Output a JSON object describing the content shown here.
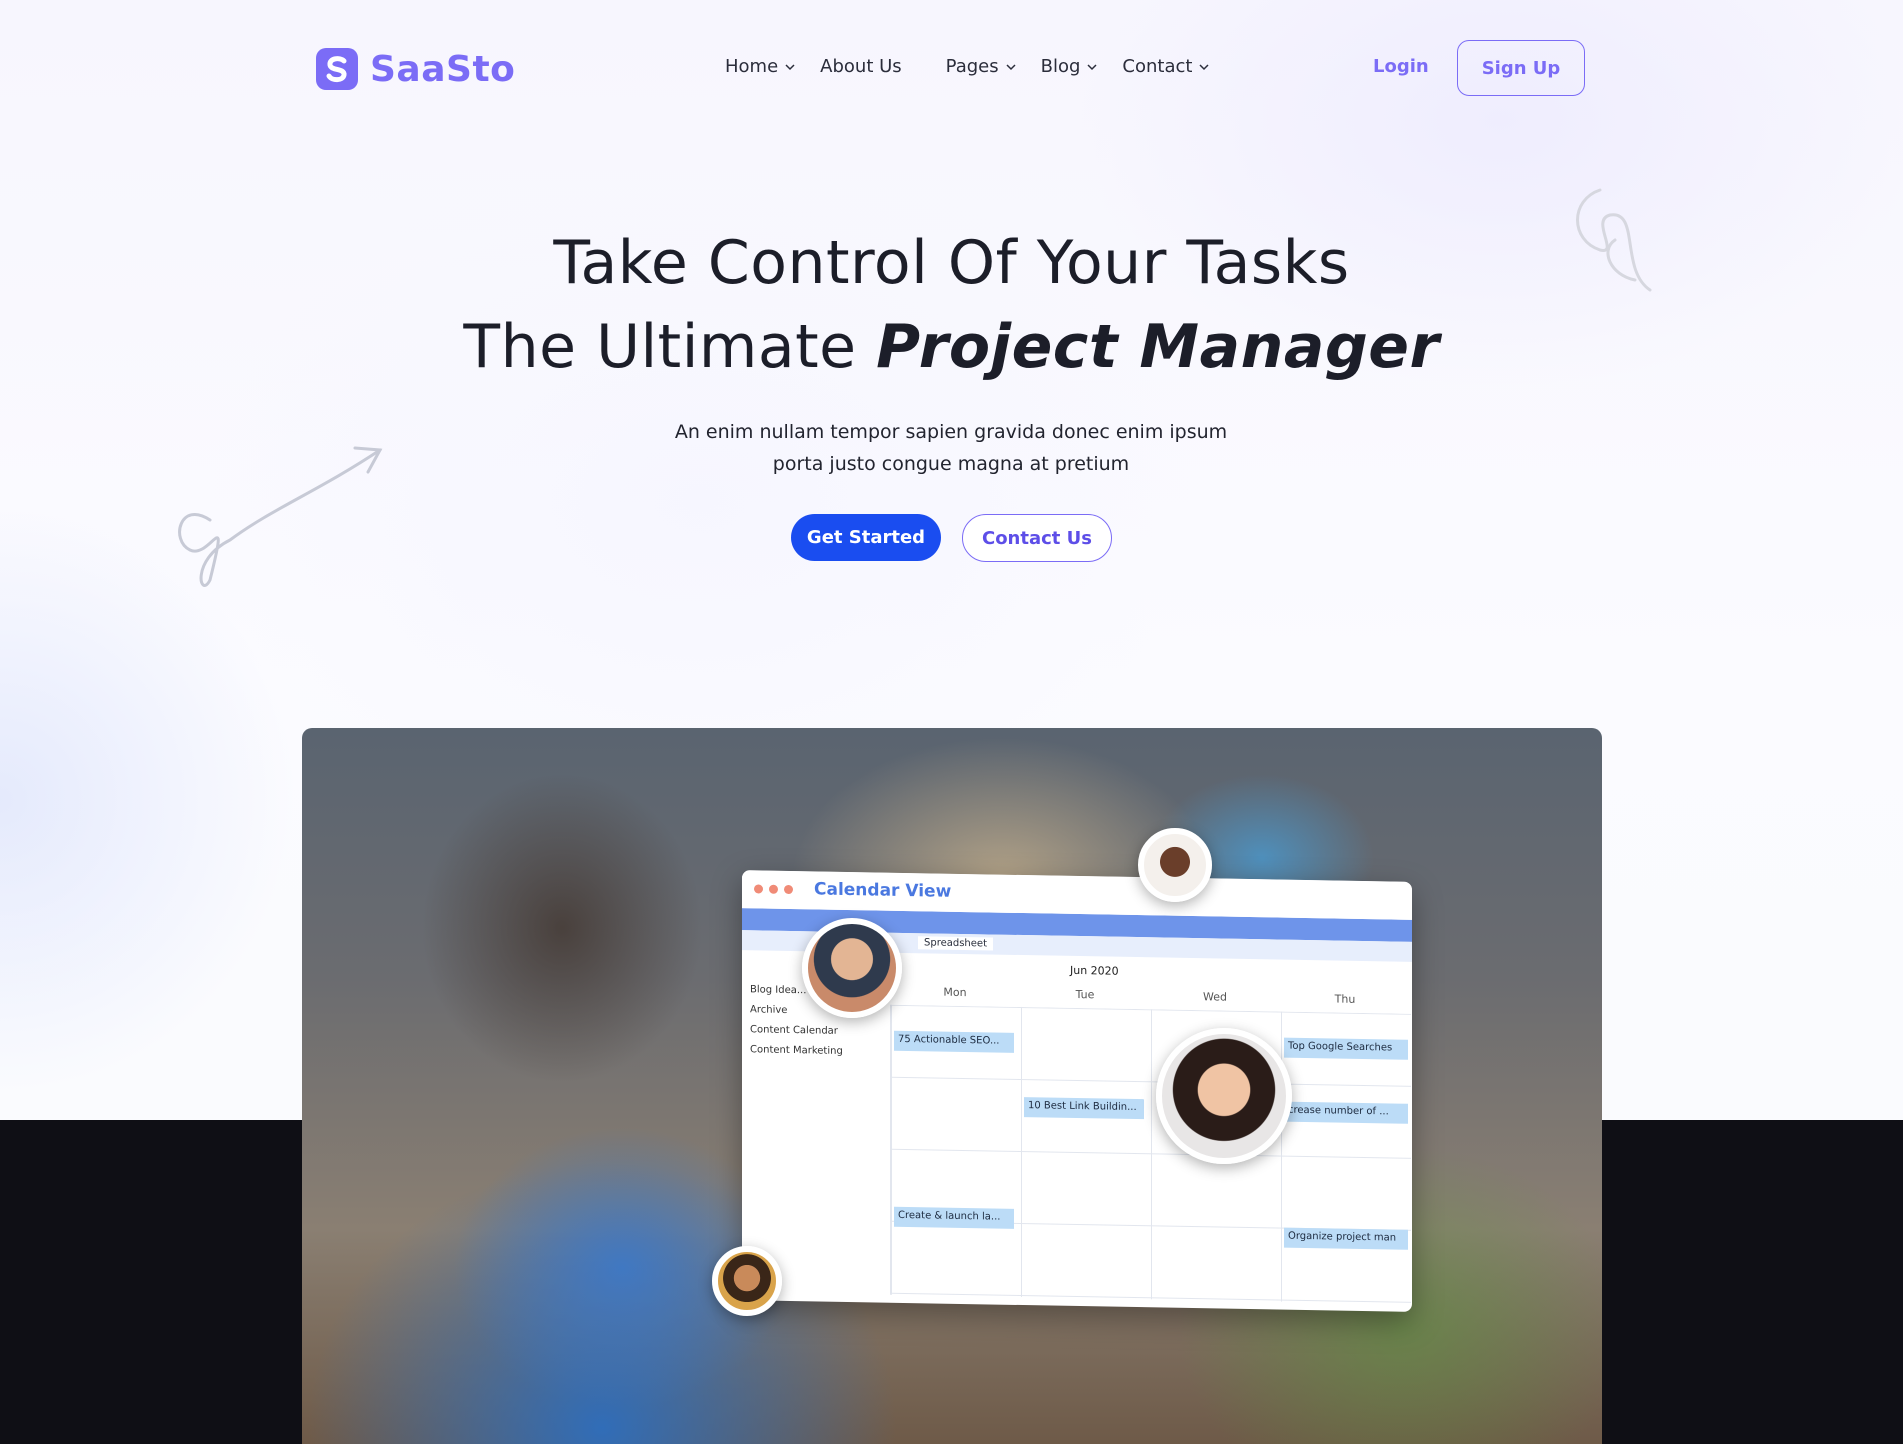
{
  "brand": {
    "name": "SaaSto",
    "color": "#7b6cf6"
  },
  "nav": {
    "items": [
      {
        "label": "Home",
        "has_dropdown": true
      },
      {
        "label": "About Us",
        "has_dropdown": false
      },
      {
        "label": "Pages",
        "has_dropdown": true
      },
      {
        "label": "Blog",
        "has_dropdown": true
      },
      {
        "label": "Contact",
        "has_dropdown": true
      }
    ],
    "login_label": "Login",
    "signup_label": "Sign Up"
  },
  "hero": {
    "title_line1": "Take Control Of Your Tasks",
    "title_line2_prefix": "The Ultimate ",
    "title_line2_highlight": "Project Manager",
    "subtitle": "An enim nullam tempor sapien gravida donec enim ipsum porta justo congue magna at pretium",
    "primary_button": "Get Started",
    "secondary_button": "Contact Us",
    "primary_color": "#1a4df0"
  },
  "app_preview": {
    "window_title": "Calendar View",
    "tab": "Spreadsheet",
    "month": "Jun 2020",
    "days": [
      "Mon",
      "Tue",
      "Wed",
      "Thu"
    ],
    "sidebar_items": [
      "Blog Idea...",
      "Archive",
      "Content Calendar",
      "Content Marketing"
    ],
    "events": [
      "75 Actionable SEO...",
      "Top Google Searches",
      "10 Best Link Buildin...",
      "crease number of ...",
      "Create & launch la...",
      "Organize project man"
    ]
  }
}
